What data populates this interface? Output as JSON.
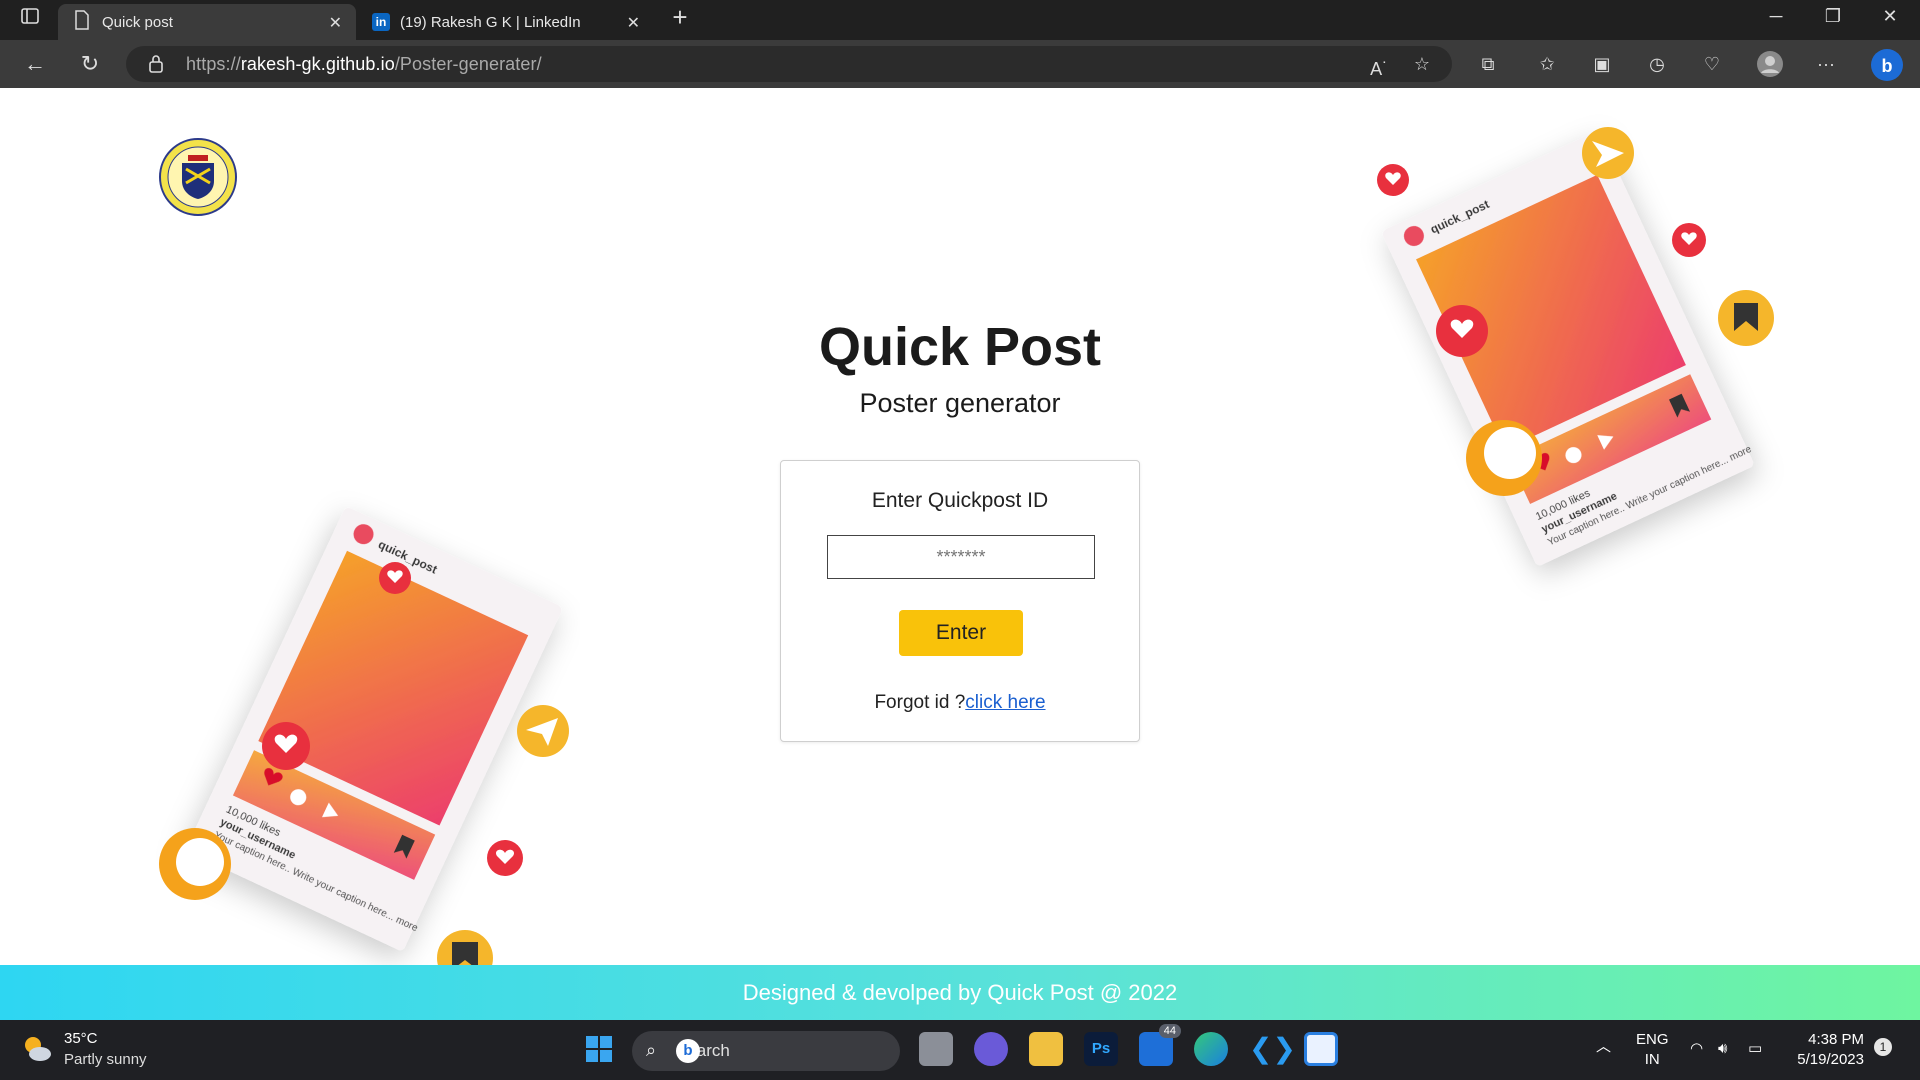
{
  "browser": {
    "tabs": [
      {
        "label": "Quick post"
      },
      {
        "label": "(19) Rakesh G K | LinkedIn"
      }
    ],
    "url_prefix": "https://",
    "url_host": "rakesh-gk.github.io",
    "url_path": "/Poster-generater/"
  },
  "page": {
    "title": "Quick Post",
    "subtitle": "Poster generator",
    "form": {
      "heading": "Enter Quickpost ID",
      "input_placeholder": "*******",
      "button_label": "Enter",
      "forgot_text": "Forgot id ?",
      "forgot_link": "click here"
    },
    "footer": "Designed & devolped by Quick Post @ 2022",
    "illustration": {
      "username": "quick_post",
      "likes": "10,000 likes",
      "caption_user": "your_username",
      "caption": "Your caption here.. Write your caption here... more"
    }
  },
  "taskbar": {
    "weather_temp": "35°C",
    "weather_desc": "Partly sunny",
    "search_label": "Search",
    "mail_badge": "44",
    "lang": "ENG",
    "region": "IN",
    "time": "4:38 PM",
    "date": "5/19/2023",
    "notif_count": "1"
  },
  "colors": {
    "accent_button": "#f9c20a",
    "link": "#1a5fd0",
    "footer_start": "#2ed6f2",
    "footer_end": "#6ef5a0"
  }
}
